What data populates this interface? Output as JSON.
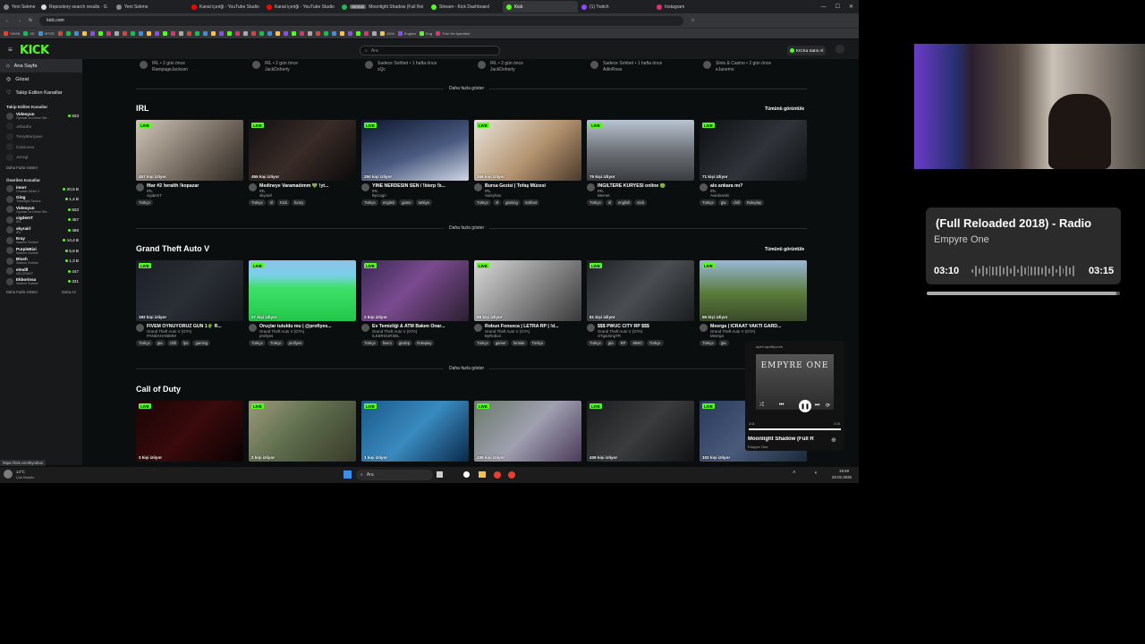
{
  "browser": {
    "tabs": [
      {
        "label": "Yeni Sekme",
        "color": "#888"
      },
      {
        "label": "Repository search results · G",
        "color": "#ddd"
      },
      {
        "label": "Yeni Sekme",
        "color": "#888"
      },
      {
        "label": "Kanal içeriği - YouTube Studio",
        "color": "#f00"
      },
      {
        "label": "Kanal içeriği - YouTube Studio",
        "color": "#f00"
      },
      {
        "label": "Moonlight Shadow (Full Rel",
        "color": "#1db954",
        "badge": "SESSİZ"
      },
      {
        "label": "Stream - Kick Dashboard",
        "color": "#53fc18"
      },
      {
        "label": "Kick",
        "color": "#53fc18",
        "active": true
      },
      {
        "label": "(1) Twitch",
        "color": "#9146ff"
      },
      {
        "label": "Instagram",
        "color": "#e1306c"
      }
    ],
    "url": "kick.com",
    "bookmarks": [
      "YAYIN",
      "3D",
      "SPOR",
      "1000",
      "English",
      "Eng",
      "Tüm Yer İşaretleri"
    ]
  },
  "kick": {
    "logo": "KICK",
    "search_placeholder": "Ara",
    "kick_satin": "KICKa Satın Al"
  },
  "sidebar": {
    "nav": [
      {
        "label": "Ana Sayfa",
        "icon": "home-icon",
        "active": true
      },
      {
        "label": "Gözat",
        "icon": "compass-icon"
      },
      {
        "label": "Takip Edilen Kanallar",
        "icon": "heart-icon"
      }
    ],
    "followed_head": "Takip Edilen Kanallar",
    "followed": [
      {
        "name": "Videoyun",
        "cat": "Oyunlar ve Deme Stir...",
        "viewers": "833",
        "online": true
      },
      {
        "name": "Jebadis",
        "cat": "",
        "viewers": "",
        "online": false
      },
      {
        "name": "TonyMarques",
        "cat": "",
        "viewers": "",
        "online": false
      },
      {
        "name": "Cubicess",
        "cat": "",
        "viewers": "",
        "online": false
      },
      {
        "name": "Jersgi",
        "cat": "",
        "viewers": "",
        "online": false
      }
    ],
    "more_label": "Daha Fazla Göster",
    "recommended_head": "Önerilen Kanallar",
    "recommended": [
      {
        "name": "imorr",
        "cat": "Counter-Strike 2",
        "viewers": "20,5 B"
      },
      {
        "name": "Ging",
        "cat": "Teamfight Tactics",
        "viewers": "1,4 B"
      },
      {
        "name": "Videoyun",
        "cat": "Oyunlar ve Deme Stir...",
        "viewers": "833"
      },
      {
        "name": "cigdemT",
        "cat": "IRL",
        "viewers": "457"
      },
      {
        "name": "skyrairl",
        "cat": "IRL",
        "viewers": "455"
      },
      {
        "name": "Eray",
        "cat": "Sadece Sohbet",
        "viewers": "14,4 B"
      },
      {
        "name": "PurpleBixi",
        "cat": "Sadece Sohbet",
        "viewers": "5,6 B"
      },
      {
        "name": "Blush",
        "cat": "Sadece Sohbet",
        "viewers": "1,3 B"
      },
      {
        "name": "elmdll",
        "cat": "VALORANT",
        "viewers": "447"
      },
      {
        "name": "Ekborinsa",
        "cat": "Sadece Sohbet",
        "viewers": "331"
      }
    ],
    "bottom_more": "Daha Fazla Göster",
    "bottom_less": "Daha Az"
  },
  "top_row": [
    {
      "ctx": "IRL • 2 gün önce",
      "name": "RampageJackson"
    },
    {
      "ctx": "IRL • 2 gün önce",
      "name": "JackDoherty"
    },
    {
      "ctx": "Sadece Sohbet • 1 hafta önce",
      "name": "xQc"
    },
    {
      "ctx": "IRL • 2 gün önce",
      "name": "JackDoherty"
    },
    {
      "ctx": "Sadece Sohbet • 1 hafta önce",
      "name": "AdinRoss"
    },
    {
      "ctx": "Slots & Casino • 2 gün önce",
      "name": "eJanemo"
    }
  ],
  "show_more": "Daha fazla göster",
  "see_all": "Tümünü görüntüle",
  "sections": [
    {
      "title": "IRL",
      "cards": [
        {
          "viewers": "457 kişi izliyor",
          "title": "İftar #2 !wralth !kopazar",
          "cat": "IRL",
          "streamer": "cigdemT",
          "tags": [
            "Türkçe"
          ],
          "bg": "linear-gradient(135deg,#cfc6b8,#6f655a 60%,#2e2a26)"
        },
        {
          "viewers": "455 kişi izliyor",
          "title": "Medineye Varamadımm 💚 !yt...",
          "cat": "IRL",
          "streamer": "skyrairl",
          "tags": [
            "Türkçe",
            "irl",
            "Kick",
            "funny"
          ],
          "bg": "linear-gradient(135deg,#111,#3a2c28 50%,#0a0a0a)"
        },
        {
          "viewers": "250 kişi izliyor",
          "title": "YİNE NERDESİN SEN / !bierp !b...",
          "cat": "IRL",
          "streamer": "ByCagri",
          "tags": [
            "Türkçe",
            "english",
            "game",
            "turkiye"
          ],
          "bg": "linear-gradient(160deg,#0e1830,#4a5a80 55%,#cfd6e4)"
        },
        {
          "viewers": "166 kişi izliyor",
          "title": "Bursa Gezisi | Tofaş Müzesi",
          "cat": "IRL",
          "streamer": "Suleyhan",
          "tags": [
            "Türkçe",
            "irl",
            "gaming",
            "Sohbet"
          ],
          "bg": "linear-gradient(135deg,#e8e2da,#b3936f 55%,#4c3a2a)"
        },
        {
          "viewers": "75 kişi izliyor",
          "title": "INGILTERE KURYESI online 🟢",
          "cat": "IRL",
          "streamer": "Memet",
          "tags": [
            "Türkçe",
            "irl",
            "english",
            "Kick"
          ],
          "bg": "linear-gradient(180deg,#b8c4d2,#70747a 50%,#3a3c40)"
        },
        {
          "viewers": "71 kişi izliyor",
          "title": "alo ankara mı?",
          "cat": "IRL",
          "streamer": "Avedowski",
          "tags": [
            "Türkçe",
            "gta",
            "chill",
            "Roleplay"
          ],
          "bg": "linear-gradient(135deg,#0d0f12,#30343a 55%,#101214)"
        }
      ]
    },
    {
      "title": "Grand Theft Auto V",
      "cards": [
        {
          "viewers": "182 kişi izliyor",
          "title": "FİVEM OYNUYORUZ GÜN 1🌵 R...",
          "cat": "Grand Theft Auto V (GTA)",
          "streamer": "PANDAHANIMM",
          "tags": [
            "Türkçe",
            "gta",
            "chill",
            "fps",
            "gaming"
          ],
          "bg": "linear-gradient(135deg,#1c2026,#2a2f36 50%,#14171b)"
        },
        {
          "viewers": "27 kişi izliyor",
          "title": "Oruçlar tutuldu mu | @profiyes...",
          "cat": "Grand Theft Auto V (GTA)",
          "streamer": "profiyes",
          "tags": [
            "Türkçe",
            "Türkçe",
            "profiyes"
          ],
          "bg": "linear-gradient(180deg,#8fc2e8 0%,#7ad0e8 25%,#3fe06a 45%,#22c84a 100%)"
        },
        {
          "viewers": "2 kişi izliyor",
          "title": "Ev Temizliği & ATM Bakım Onar...",
          "cat": "Grand Theft Auto V (GTA)",
          "streamer": "ILKERGURSEL",
          "tags": [
            "Türkçe",
            "fivem",
            "gtaSrp",
            "Roleplay"
          ],
          "bg": "linear-gradient(135deg,#3b2a55,#7a4a8f 45%,#2a2030)"
        },
        {
          "viewers": "88 kişi izliyor",
          "title": "Robun Fonseca | LETRA RP | !d...",
          "cat": "Grand Theft Auto V (GTA)",
          "streamer": "ByRobun",
          "tags": [
            "Türkçe",
            "gamer",
            "fortnite",
            "Türkçe"
          ],
          "bg": "linear-gradient(135deg,#d8d8d8,#8a8a8a 50%,#3a3a3a)"
        },
        {
          "viewers": "61 kişi izliyor",
          "title": "$$$ PWUC CİTY RP $$$",
          "cat": "Grand Theft Auto V (GTA)",
          "streamer": "STgamingTR",
          "tags": [
            "Türkçe",
            "gta",
            "RP",
            "MMO",
            "Türkçe"
          ],
          "bg": "linear-gradient(135deg,#1e2226,#4a4e52 50%,#1a1c1e)"
        },
        {
          "viewers": "55 kişi izliyor",
          "title": "Meerga | İCRAAT VAKTİ GARD...",
          "cat": "Grand Theft Auto V (GTA)",
          "streamer": "Meerga",
          "tags": [
            "Türkçe",
            "gta"
          ],
          "bg": "linear-gradient(180deg,#9ab8d8,#5a7a3a 55%,#3a4a2a)"
        }
      ]
    },
    {
      "title": "Call of Duty",
      "cards": [
        {
          "viewers": "3 kişi izliyor",
          "bg": "linear-gradient(135deg,#1a0506,#3a0a0c 50%,#0a0203)"
        },
        {
          "viewers": "2 kişi izliyor",
          "bg": "linear-gradient(135deg,#9a9a7a,#5a6a4a 50%,#3a3a2a)"
        },
        {
          "viewers": "1 kişi izliyor",
          "bg": "linear-gradient(135deg,#1a5a8a,#3a8ac0 50%,#0a2a4a)"
        },
        {
          "viewers": "436 kişi izliyor",
          "bg": "linear-gradient(135deg,#6a7a6a,#a0a0b0 50%,#4a3a5a)"
        },
        {
          "viewers": "436 kişi izliyor",
          "bg": "linear-gradient(135deg,#1a1c1e,#3a3c3e 50%,#101214)"
        },
        {
          "viewers": "102 kişi izliyor",
          "bg": "linear-gradient(135deg,#2a3a5a,#4a5a7a 50%,#1a2a3a)"
        }
      ]
    }
  ],
  "status_url": "https://kick.com/byrobun",
  "taskbar": {
    "weather_temp": "14°C",
    "weather_desc": "Çok Bulutlu",
    "search": "Ara",
    "time": "19:49",
    "date": "20.02.2026"
  },
  "spotify_mini": {
    "url": "open.spotify.com",
    "art_title": "EMPYRE ONE",
    "title": "Moonlight Shadow (Full R",
    "artist": "Empyre One",
    "elapsed": "3:11",
    "total": "3:15"
  },
  "now_playing": {
    "title": "(Full Reloaded 2018) - Radio",
    "artist": "Empyre One",
    "current": "03:10",
    "duration": "03:15",
    "progress": 0.98
  }
}
